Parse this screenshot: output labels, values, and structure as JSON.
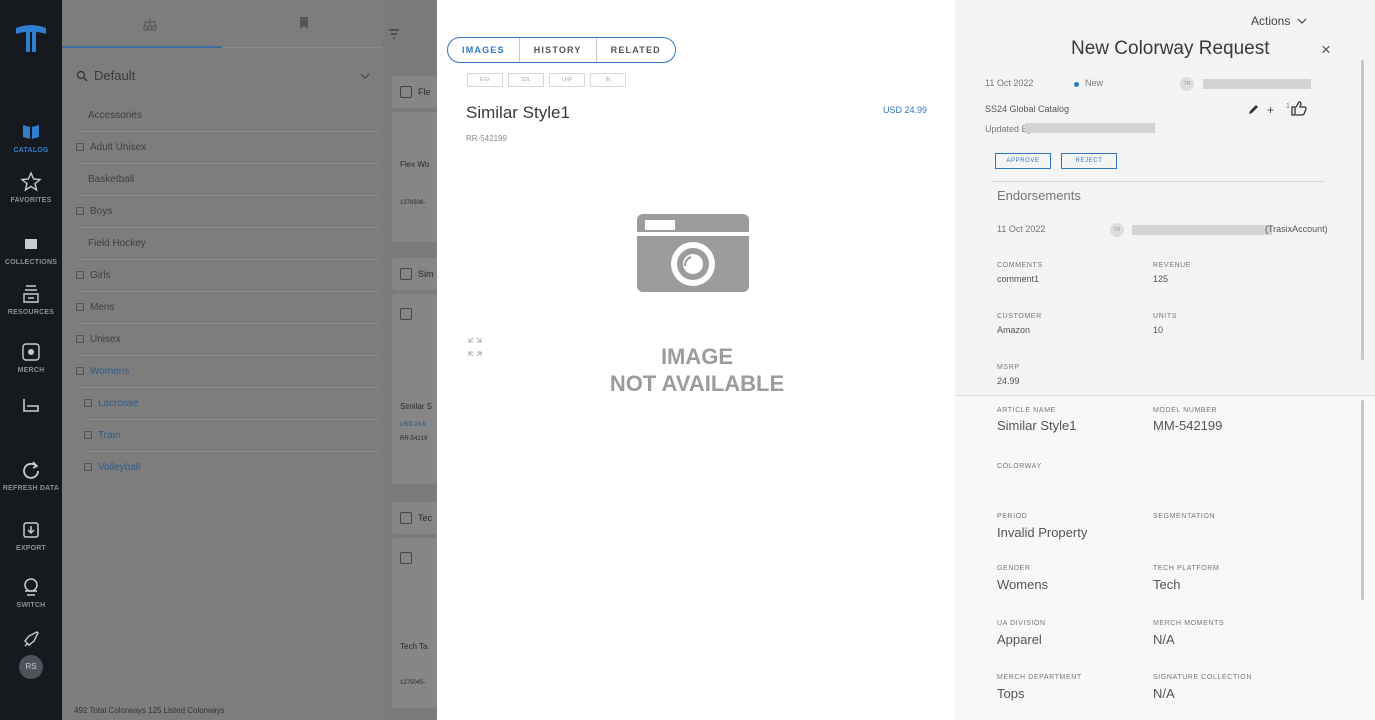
{
  "rail": {
    "items": [
      {
        "label": "CATALOG",
        "icon": "catalog-icon"
      },
      {
        "label": "FAVORITES",
        "icon": "star-icon"
      },
      {
        "label": "COLLECTIONS",
        "icon": "folder-icon"
      },
      {
        "label": "RESOURCES",
        "icon": "resources-icon"
      },
      {
        "label": "MERCH",
        "icon": "merch-icon"
      },
      {
        "label": "",
        "icon": "hanger-icon"
      },
      {
        "label": "REFRESH DATA",
        "icon": "refresh-icon"
      },
      {
        "label": "EXPORT",
        "icon": "export-icon"
      },
      {
        "label": "SWITCH",
        "icon": "switch-icon"
      },
      {
        "label": "",
        "icon": "rocket-icon"
      }
    ],
    "avatar": "RS"
  },
  "tree": {
    "search_value": "Default",
    "items": [
      {
        "label": "Accessories"
      },
      {
        "label": "Adult Unisex"
      },
      {
        "label": "Basketball"
      },
      {
        "label": "Boys"
      },
      {
        "label": "Field Hockey"
      },
      {
        "label": "Girls"
      },
      {
        "label": "Mens"
      },
      {
        "label": "Unisex"
      },
      {
        "label": "Womens"
      },
      {
        "label": "Lacrosse"
      },
      {
        "label": "Train"
      },
      {
        "label": "Volleyball"
      }
    ],
    "footer": "492 Total Colorways   125 Listed Colorways"
  },
  "list": {
    "card1": {
      "name": "Flex Wo",
      "sku": "1376936-"
    },
    "card2": {
      "name": "Similar S",
      "price": "USD 24.9",
      "sku": "RR-54219"
    },
    "card3": {
      "name": "Tech Ta",
      "sku": "1275045-"
    },
    "hdr_fle": "Fle",
    "hdr_sim": "Sim",
    "hdr_tec": "Tec"
  },
  "main": {
    "tabs": [
      "IMAGES",
      "HISTORY",
      "RELATED"
    ],
    "thumbs": [
      "EXX",
      "SDL",
      "LMP",
      "IN"
    ],
    "style_name": "Similar Style1",
    "price": "USD 24.99",
    "sku": "RR-542199",
    "no_image_line1": "IMAGE",
    "no_image_line2": "NOT AVAILABLE"
  },
  "detail": {
    "actions_label": "Actions",
    "title": "New Colorway Request",
    "close": "×",
    "date": "11 Oct 2022",
    "status": "New",
    "initials": "TR",
    "catalog": "SS24 Global Catalog",
    "updated_by_label": "Updated By:",
    "approve_label": "APPROVE",
    "reject_label": "REJECT",
    "like_count": "1",
    "plus": "+",
    "endorsements_label": "Endorsements",
    "endorse_date": "11 Oct 2022",
    "endorse_account": "(TrasixAccount)",
    "fields": {
      "comments_label": "COMMENTS",
      "comments": "comment1",
      "revenue_label": "REVENUE",
      "revenue": "125",
      "customer_label": "CUSTOMER",
      "customer": "Amazon",
      "units_label": "UNITS",
      "units": "10",
      "msrp_label": "MSRP",
      "msrp": "24.99"
    },
    "article": {
      "article_name_label": "ARTICLE NAME",
      "article_name": "Similar Style1",
      "model_number_label": "MODEL NUMBER",
      "model_number": "MM-542199",
      "colorway_label": "COLORWAY",
      "period_label": "PERIOD",
      "period": "Invalid Property",
      "segmentation_label": "SEGMENTATION",
      "gender_label": "GENDER",
      "gender": "Womens",
      "tech_platform_label": "TECH PLATFORM",
      "tech_platform": "Tech",
      "ua_division_label": "UA DIVISION",
      "ua_division": "Apparel",
      "merch_moments_label": "MERCH MOMENTS",
      "merch_moments": "N/A",
      "merch_department_label": "MERCH DEPARTMENT",
      "merch_department": "Tops",
      "signature_collection_label": "SIGNATURE COLLECTION",
      "signature_collection": "N/A"
    }
  },
  "colors": {
    "accent": "#2f78c4",
    "rail": "#161a1f",
    "overlay": "#7f7f7f"
  }
}
